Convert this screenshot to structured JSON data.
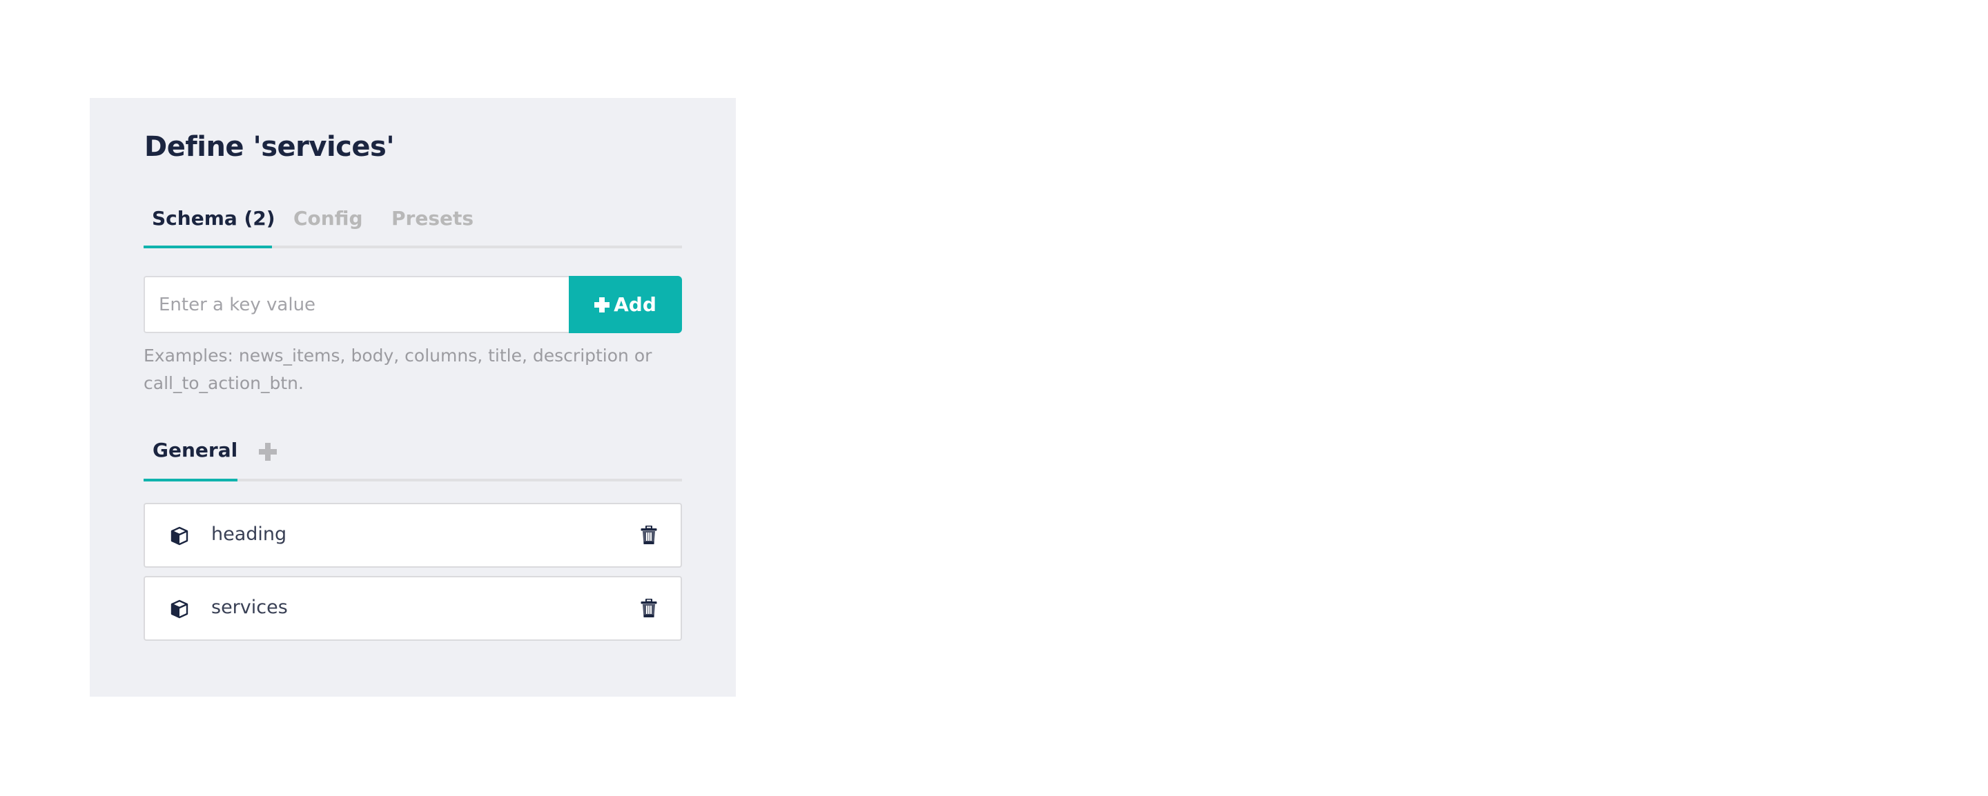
{
  "panel": {
    "title": "Define 'services'",
    "tabs": [
      {
        "label": "Schema (2)",
        "active": true
      },
      {
        "label": "Config",
        "active": false
      },
      {
        "label": "Presets",
        "active": false
      }
    ],
    "key_input": {
      "placeholder": "Enter a key value",
      "value": ""
    },
    "add_button": {
      "label": "Add",
      "icon": "plus-icon"
    },
    "help_text": "Examples: news_items, body, columns, title, description or call_to_action_btn.",
    "group_tabs": [
      {
        "label": "General",
        "active": true
      }
    ],
    "add_group_icon": "plus-icon",
    "fields": [
      {
        "label": "heading",
        "icon": "cube-icon",
        "action_icon": "trash-icon"
      },
      {
        "label": "services",
        "icon": "cube-icon",
        "action_icon": "trash-icon"
      }
    ]
  },
  "colors": {
    "accent": "#0cb3ae",
    "text_dark": "#1b2540",
    "text_muted": "#b8b8b8",
    "panel_bg": "#eff0f4"
  }
}
